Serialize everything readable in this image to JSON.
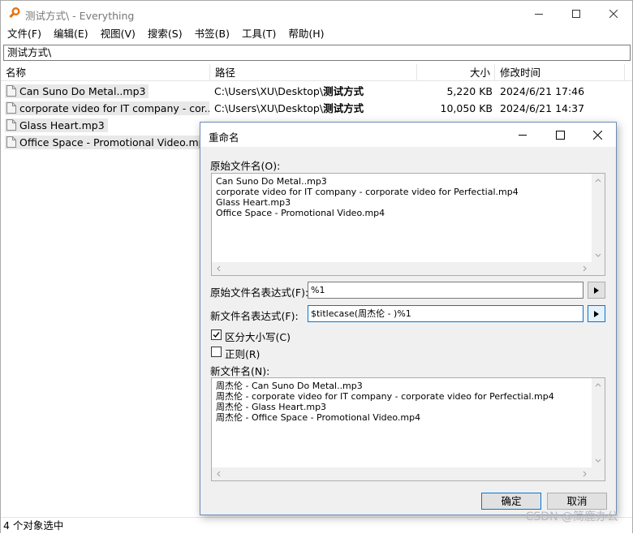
{
  "window": {
    "title": "测试方式\\ - Everything"
  },
  "menu": [
    "文件(F)",
    "编辑(E)",
    "视图(V)",
    "搜索(S)",
    "书签(B)",
    "工具(T)",
    "帮助(H)"
  ],
  "search": {
    "value": "测试方式\\"
  },
  "columns": {
    "name": "名称",
    "path": "路径",
    "size": "大小",
    "date": "修改时间"
  },
  "rows": [
    {
      "name": "Can Suno Do Metal..mp3",
      "path_prefix": "C:\\Users\\XU\\Desktop\\",
      "path_bold": "测试方式",
      "size": "5,220 KB",
      "date": "2024/6/21 17:46"
    },
    {
      "name": "corporate video for IT company - cor...",
      "path_prefix": "C:\\Users\\XU\\Desktop\\",
      "path_bold": "测试方式",
      "size": "10,050 KB",
      "date": "2024/6/21 14:37"
    },
    {
      "name": "Glass Heart.mp3",
      "path_prefix": "",
      "path_bold": "",
      "size": "",
      "date": ""
    },
    {
      "name": "Office Space - Promotional Video.mp4",
      "path_prefix": "",
      "path_bold": "",
      "size": "",
      "date": ""
    }
  ],
  "status": {
    "text": "4 个对象选中"
  },
  "watermark": "CSDN @简鹿办公",
  "dialog": {
    "title": "重命名",
    "original_label": "原始文件名(O):",
    "original_names": [
      "Can Suno Do Metal..mp3",
      "corporate video for IT company - corporate video for Perfectial.mp4",
      "Glass Heart.mp3",
      "Office Space - Promotional Video.mp4"
    ],
    "orig_expr_label": "原始文件名表达式(F):",
    "orig_expr_value": "%1",
    "new_expr_label": "新文件名表达式(F):",
    "new_expr_value": "$titlecase(周杰伦 - )%1",
    "case_label": "区分大小写(C)",
    "case_checked": true,
    "regex_label": "正则(R)",
    "regex_checked": false,
    "new_label": "新文件名(N):",
    "new_names": [
      "周杰伦 - Can Suno Do Metal..mp3",
      "周杰伦 - corporate video for IT company - corporate video for Perfectial.mp4",
      "周杰伦 - Glass Heart.mp3",
      "周杰伦 - Office Space - Promotional Video.mp4"
    ],
    "ok_label": "确定",
    "cancel_label": "取消"
  },
  "colors": {
    "accent": "#0078d7",
    "dialog_bg": "#f0f0f0",
    "app_icon": "#e8730c"
  },
  "icons": [
    "app-search-icon",
    "minimize-icon",
    "maximize-icon",
    "close-icon",
    "file-icon",
    "arrow-right-icon",
    "checkmark-icon"
  ]
}
